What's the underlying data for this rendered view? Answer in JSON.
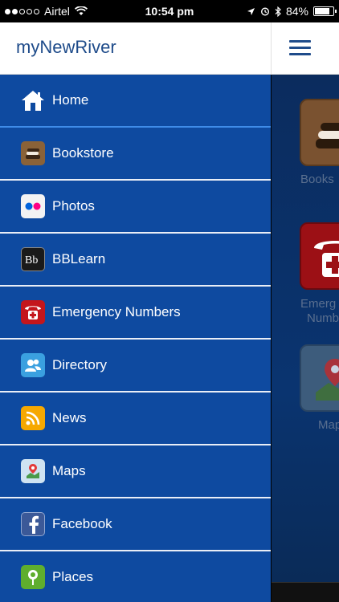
{
  "status_bar": {
    "carrier": "Airtel",
    "time": "10:54 pm",
    "battery": "84%",
    "battery_level": 0.84
  },
  "header": {
    "title": "myNewRiver"
  },
  "menu": {
    "items": [
      {
        "label": "Home",
        "icon": "home-icon"
      },
      {
        "label": "Bookstore",
        "icon": "books-icon"
      },
      {
        "label": "Photos",
        "icon": "flickr-icon"
      },
      {
        "label": "BBLearn",
        "icon": "blackboard-icon"
      },
      {
        "label": "Emergency Numbers",
        "icon": "emergency-phone-icon"
      },
      {
        "label": "Directory",
        "icon": "people-icon"
      },
      {
        "label": "News",
        "icon": "rss-icon"
      },
      {
        "label": "Maps",
        "icon": "map-pin-icon"
      },
      {
        "label": "Facebook",
        "icon": "facebook-icon"
      },
      {
        "label": "Places",
        "icon": "places-pin-icon"
      }
    ]
  },
  "background_grid": {
    "labels": [
      "Books",
      "Emerg",
      "Numb",
      "Map"
    ]
  }
}
